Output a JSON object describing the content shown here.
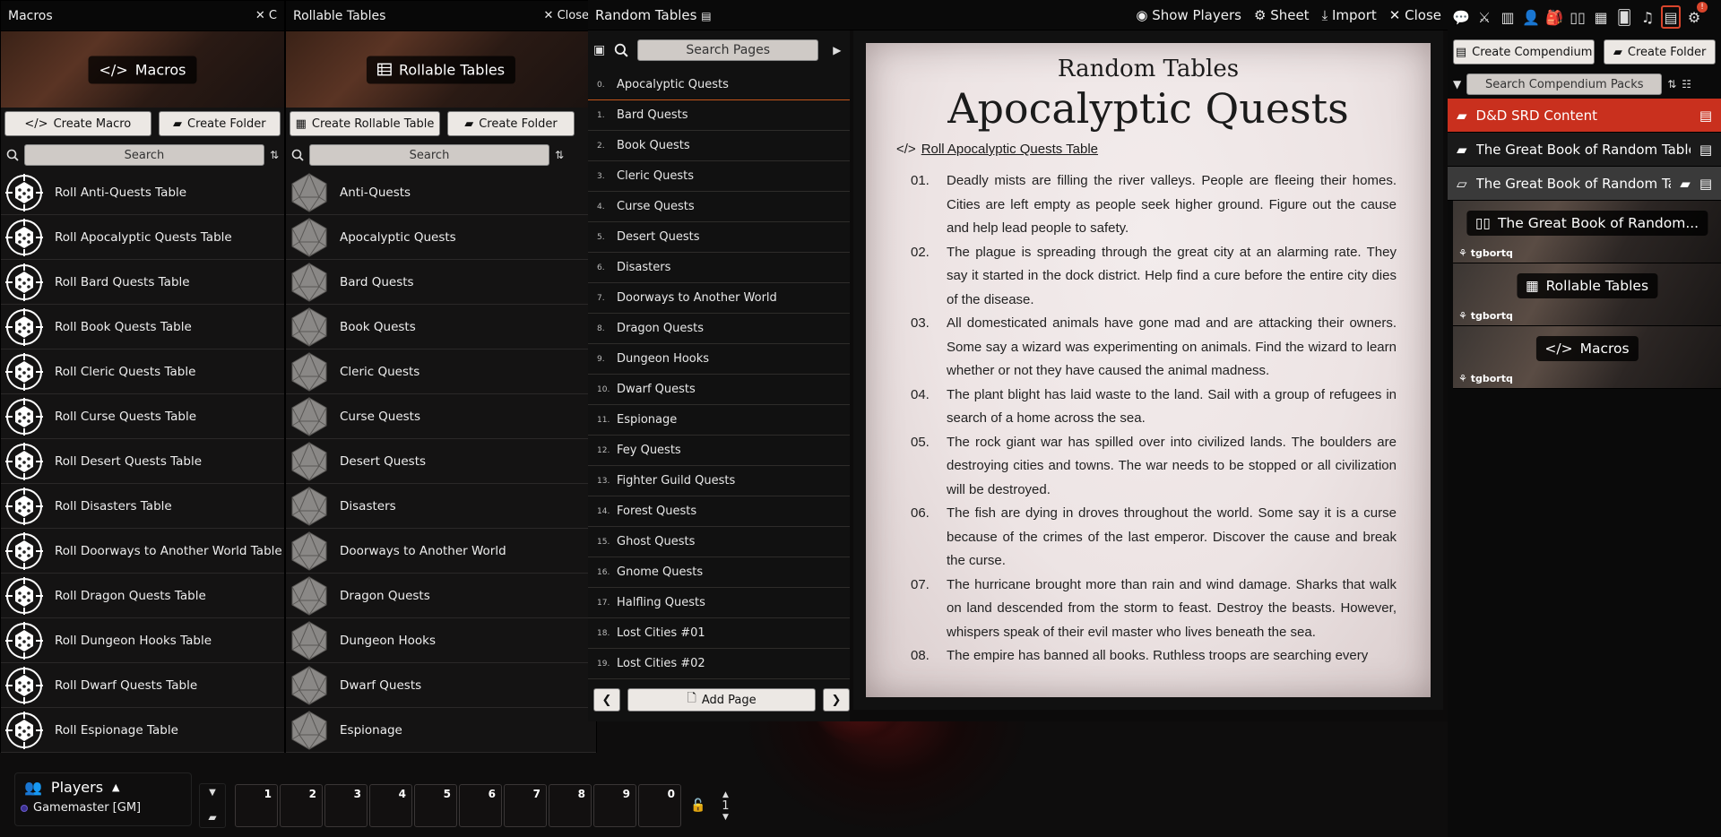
{
  "macros_window": {
    "title": "Macros",
    "close_label": "C",
    "banner_label": "Macros",
    "create_macro": "Create Macro",
    "create_folder": "Create Folder",
    "search_placeholder": "Search",
    "items": [
      "Roll Anti-Quests Table",
      "Roll Apocalyptic Quests Table",
      "Roll Bard Quests Table",
      "Roll Book Quests Table",
      "Roll Cleric Quests Table",
      "Roll Curse Quests Table",
      "Roll Desert Quests Table",
      "Roll Disasters Table",
      "Roll Doorways to Another World Table",
      "Roll Dragon Quests Table",
      "Roll Dungeon Hooks Table",
      "Roll Dwarf Quests Table",
      "Roll Espionage Table"
    ]
  },
  "tables_window": {
    "title": "Rollable Tables",
    "close_label": "Close",
    "banner_label": "Rollable Tables",
    "create_table": "Create Rollable Table",
    "create_folder": "Create Folder",
    "search_placeholder": "Search",
    "items": [
      "Anti-Quests",
      "Apocalyptic Quests",
      "Bard Quests",
      "Book Quests",
      "Cleric Quests",
      "Curse Quests",
      "Desert Quests",
      "Disasters",
      "Doorways to Another World",
      "Dragon Quests",
      "Dungeon Hooks",
      "Dwarf Quests",
      "Espionage"
    ]
  },
  "journal": {
    "title": "Random Tables",
    "show_players": "Show Players",
    "sheet": "Sheet",
    "import": "Import",
    "close": "Close",
    "search_placeholder": "Search Pages",
    "add_page": "Add Page",
    "pages": [
      {
        "n": "0.",
        "label": "Apocalyptic Quests"
      },
      {
        "n": "1.",
        "label": "Bard Quests"
      },
      {
        "n": "2.",
        "label": "Book Quests"
      },
      {
        "n": "3.",
        "label": "Cleric Quests"
      },
      {
        "n": "4.",
        "label": "Curse Quests"
      },
      {
        "n": "5.",
        "label": "Desert Quests"
      },
      {
        "n": "6.",
        "label": "Disasters"
      },
      {
        "n": "7.",
        "label": "Doorways to Another World"
      },
      {
        "n": "8.",
        "label": "Dragon Quests"
      },
      {
        "n": "9.",
        "label": "Dungeon Hooks"
      },
      {
        "n": "10.",
        "label": "Dwarf Quests"
      },
      {
        "n": "11.",
        "label": "Espionage"
      },
      {
        "n": "12.",
        "label": "Fey Quests"
      },
      {
        "n": "13.",
        "label": "Fighter Guild Quests"
      },
      {
        "n": "14.",
        "label": "Forest Quests"
      },
      {
        "n": "15.",
        "label": "Ghost Quests"
      },
      {
        "n": "16.",
        "label": "Gnome Quests"
      },
      {
        "n": "17.",
        "label": "Halfling Quests"
      },
      {
        "n": "18.",
        "label": "Lost Cities #01"
      },
      {
        "n": "19.",
        "label": "Lost Cities #02"
      }
    ],
    "page_header": "Random Tables",
    "page_title": "Apocalyptic Quests",
    "roll_link": "Roll Apocalyptic Quests Table",
    "entries": [
      {
        "n": "01.",
        "text": "Deadly mists are filling the river valleys. People are fleeing their homes. Cities are left empty as people seek higher ground. Figure out the cause and help lead people to safety."
      },
      {
        "n": "02.",
        "text": "The plague is spreading through the great city at an alarming rate. They say it started in the dock district. Help find a cure before the entire city dies of the disease."
      },
      {
        "n": "03.",
        "text": "All domesticated animals have gone mad and are attacking their owners. Some say a wizard was experimenting on animals. Find the wizard to learn whether or not they have caused the animal madness."
      },
      {
        "n": "04.",
        "text": "The plant blight has laid waste to the land. Sail with a group of refugees in search of a home across the sea."
      },
      {
        "n": "05.",
        "text": "The rock giant war has spilled over into civilized lands. The boulders are destroying cities and towns. The war needs to be stopped or all civilization will be destroyed."
      },
      {
        "n": "06.",
        "text": "The fish are dying in droves throughout the world. Some say it is a curse because of the crimes of the last emperor. Discover the cause and break the curse."
      },
      {
        "n": "07.",
        "text": "The hurricane brought more than rain and wind damage. Sharks that walk on land descended from the storm to feast. Destroy the beasts. However, whispers speak of their evil master who lives beneath the sea."
      },
      {
        "n": "08.",
        "text": "The empire has banned all books. Ruthless troops are searching every"
      }
    ]
  },
  "sidebar": {
    "create_compendium": "Create Compendium",
    "create_folder": "Create Folder",
    "search_placeholder": "Search Compendium Packs",
    "folders": [
      {
        "label": "D&D SRD Content",
        "color": "#c9301e"
      },
      {
        "label": "The Great Book of Random Tables",
        "color": "#1a1a1a"
      },
      {
        "label": "The Great Book of Random Tabl",
        "color": "#3a3a3a"
      }
    ],
    "packs": [
      {
        "label": "The Great Book of Random...",
        "owner": "tgbortq"
      },
      {
        "label": "Rollable Tables",
        "owner": "tgbortq"
      },
      {
        "label": "Macros",
        "owner": "tgbortq"
      }
    ],
    "notification": "!"
  },
  "players": {
    "title": "Players",
    "users": [
      "Gamemaster [GM]"
    ]
  },
  "hotbar": {
    "slots": [
      "1",
      "2",
      "3",
      "4",
      "5",
      "6",
      "7",
      "8",
      "9",
      "0"
    ],
    "page": "1"
  },
  "colors": {
    "accent": "#c4561b",
    "srd_red": "#c9301e"
  }
}
